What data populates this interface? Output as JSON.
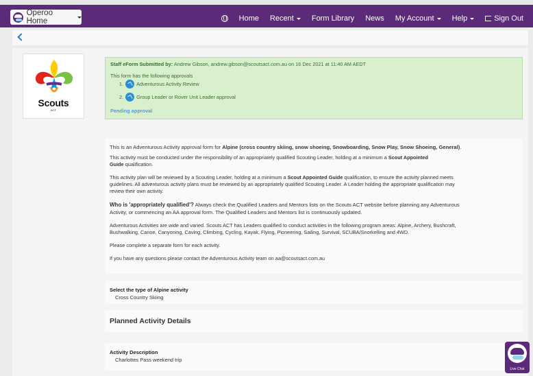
{
  "nav": {
    "home_label": "Operoo Home",
    "items": [
      "Home",
      "Recent",
      "Form Library",
      "News",
      "My Account",
      "Help",
      "Sign Out"
    ]
  },
  "logo": {
    "brand": "Scouts",
    "region": "ACT"
  },
  "approval": {
    "submitted_label": "Staff eForm Submitted by:",
    "submitted_text": "Andrew Gibson, andrew.gibson@scoutsact.com.au on 16 Dec 2021 at 11:40 AM AEDT",
    "approvals_intro": "This form has the following approvals",
    "items": [
      {
        "num": "1.",
        "label": "Adventurous Activity Review"
      },
      {
        "num": "2.",
        "label": "Group Leader or Rover Unit Leader approval"
      }
    ],
    "status": "Pending approval"
  },
  "info": {
    "p1_a": "This is an Adventurous Activity approval form for ",
    "p1_b": "Alpine (cross country skiing, snow shoeing, Snowboarding, Snow Play, Snow Shoeing, General)",
    "p1_c": ".",
    "p2_a": "This activity must be conducted under the responsibility of an appropriately qualified Scouting Leader, holding at a minimum a ",
    "p2_b": "Scout Appointed",
    "p2_c": "Guide",
    "p2_d": " qualification.",
    "p3_a": "This activity plan will be reviewed by a Scouting Leader, holding at a minimum a ",
    "p3_b": "Scout Appointed Guide",
    "p3_c": " qualification, to ensure the activity planned meets",
    "p3_d": "guidelines.  All adventurous activity plans must be reviewed by an appropriately qualified Scouting Leader. A Leader holding the appropriate qualification may",
    "p3_e": "review their own activity.",
    "p4_a": "Who is 'appropriately qualified'?",
    "p4_b": " Always check the Qualified Leaders and Mentors lists on the Scouts ACT website before planning any Adventurous",
    "p4_c": "Activity, or commencing an AA approval form.  The Qualified Leaders and Mentors list is continuously updated.",
    "p5_a": "Adventurous Activities are wide and varied.  Scouts ACT has Leaders qualified to conduct activities in the following program areas: Alpine, Archery, Bushcraft,",
    "p5_b": "Bushwalking, Canoe, Canyoning, Caving, Climbing, Cycling, Kayak, Flying, Pioneering, Sailing, Survival, SCUBA/Snorkelling and 4WD.",
    "p6": "Please complete a separate form for each activity.",
    "p7": "If you have any questions please contact the Adventurous Activity team on aa@scoutsact.com.au"
  },
  "activity_type": {
    "label": "Select the type of Alpine activity",
    "value": "Cross Country Skiing"
  },
  "planned": {
    "heading": "Planned Activity Details"
  },
  "description": {
    "label": "Activity Description",
    "value": "Charlottes Pass weekend trip"
  },
  "livechat": {
    "label": "Live Chat"
  }
}
